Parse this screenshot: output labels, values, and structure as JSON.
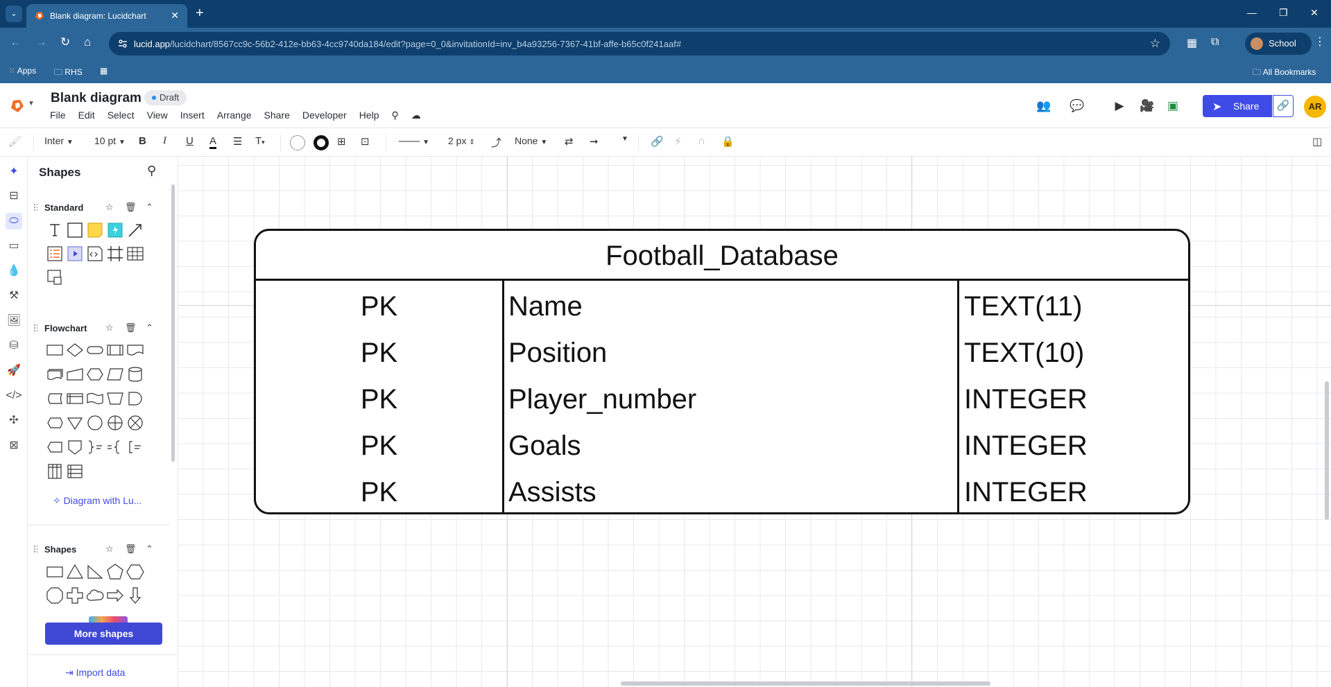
{
  "browser": {
    "tab_title": "Blank diagram: Lucidchart",
    "url_host": "lucid.app",
    "url_path": "/lucidchart/8567cc9c-56b2-412e-bb63-4cc9740da184/edit?page=0_0&invitationId=inv_b4a93256-7367-41bf-affe-b65c0f241aaf#",
    "profile_label": "School",
    "bookmarks": [
      "Apps",
      "RHS"
    ],
    "all_bookmarks": "All Bookmarks"
  },
  "header": {
    "doc_title": "Blank diagram",
    "status_badge": "Draft",
    "menu": [
      "File",
      "Edit",
      "Select",
      "View",
      "Insert",
      "Arrange",
      "Share",
      "Developer",
      "Help"
    ],
    "share_label": "Share",
    "user_initials": "AR"
  },
  "toolbar": {
    "font": "Inter",
    "font_size": "10 pt",
    "line_width": "2 px",
    "endpoint": "None"
  },
  "panel": {
    "title": "Shapes",
    "libraries": [
      {
        "name": "Standard"
      },
      {
        "name": "Flowchart"
      },
      {
        "name": "Shapes"
      }
    ],
    "diagram_ai_label": "Diagram with Lu...",
    "more_shapes_label": "More shapes",
    "import_label": "Import data"
  },
  "entity": {
    "title": "Football_Database",
    "rows": [
      {
        "key": "PK",
        "field": "Name",
        "type": "TEXT(11)"
      },
      {
        "key": "PK",
        "field": "Position",
        "type": "TEXT(10)"
      },
      {
        "key": "PK",
        "field": "Player_number",
        "type": "INTEGER"
      },
      {
        "key": "PK",
        "field": "Goals",
        "type": "INTEGER"
      },
      {
        "key": "PK",
        "field": "Assists",
        "type": "INTEGER"
      }
    ]
  },
  "colors": {
    "chrome_dark": "#0e3e6b",
    "chrome": "#2c6699",
    "accent": "#3f4be6",
    "avatar": "#f5b700"
  }
}
